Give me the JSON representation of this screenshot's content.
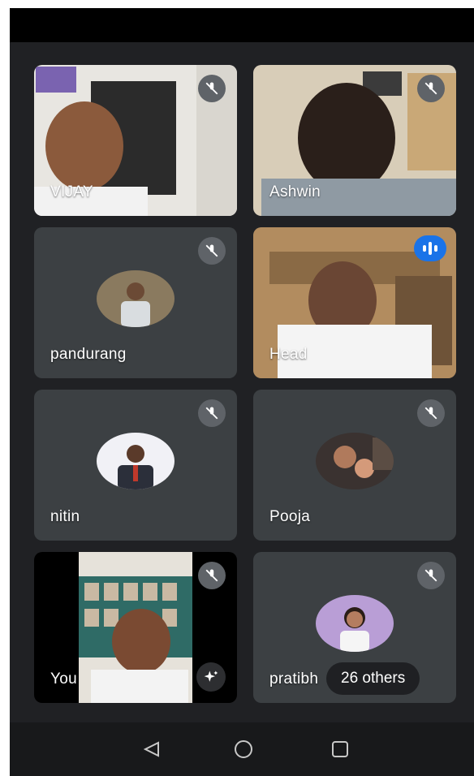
{
  "participants": [
    {
      "name": "VIJAY",
      "muted": true
    },
    {
      "name": "Ashwin",
      "muted": true
    },
    {
      "name": "pandurang",
      "muted": true
    },
    {
      "name": "Head",
      "muted": false,
      "speaking": true
    },
    {
      "name": "nitin",
      "muted": true
    },
    {
      "name": "Pooja",
      "muted": true
    },
    {
      "name": "You",
      "muted": true
    },
    {
      "name": "pratibh",
      "muted": true
    }
  ],
  "others_chip": {
    "label": "26 others"
  },
  "icons": {
    "mute": "mic-off-icon",
    "speaking": "audio-level-icon",
    "effects": "sparkle-icon",
    "nav_back": "back-triangle-icon",
    "nav_home": "home-circle-icon",
    "nav_recents": "recents-square-icon"
  },
  "colors": {
    "tile_bg": "#3c4043",
    "grid_bg": "#202124",
    "speaking_accent": "#1a73e8"
  }
}
